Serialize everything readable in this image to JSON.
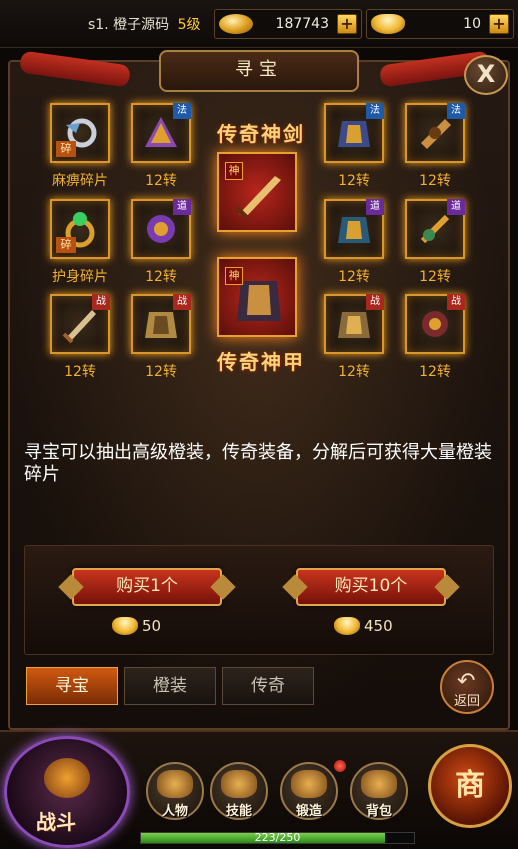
{
  "header": {
    "server_name": "s1. 橙子源码",
    "level": "5级",
    "gold": "187743",
    "ingot": "10",
    "plus_label": "+"
  },
  "panel": {
    "title": "寻宝",
    "close_label": "X",
    "legend_sword": "传奇神剑",
    "legend_armor": "传奇神甲",
    "shen_tag": "神",
    "items_left": [
      {
        "caption": "麻痹碎片",
        "tag": "",
        "frag": "碎",
        "icon": "ring-icon"
      },
      {
        "caption": "12转",
        "tag": "法",
        "frag": "",
        "icon": "gear-icon"
      },
      {
        "caption": "护身碎片",
        "tag": "",
        "frag": "碎",
        "icon": "ring-icon"
      },
      {
        "caption": "12转",
        "tag": "道",
        "frag": "",
        "icon": "gear-icon"
      },
      {
        "caption": "12转",
        "tag": "战",
        "frag": "",
        "icon": "sword-icon"
      },
      {
        "caption": "12转",
        "tag": "战",
        "frag": "",
        "icon": "armor-icon"
      }
    ],
    "items_right": [
      {
        "caption": "12转",
        "tag": "法",
        "icon": "armor-icon"
      },
      {
        "caption": "12转",
        "tag": "法",
        "icon": "gear-icon"
      },
      {
        "caption": "12转",
        "tag": "道",
        "icon": "armor-icon"
      },
      {
        "caption": "12转",
        "tag": "道",
        "icon": "gear-icon"
      },
      {
        "caption": "12转",
        "tag": "战",
        "icon": "armor-icon"
      },
      {
        "caption": "12转",
        "tag": "战",
        "icon": "gear-icon"
      }
    ],
    "description": "寻宝可以抽出高级橙装，传奇装备，分解后可获得大量橙装碎片"
  },
  "buy": {
    "one_label": "购买1个",
    "one_price": "50",
    "ten_label": "购买10个",
    "ten_price": "450"
  },
  "tabs": [
    {
      "label": "寻宝",
      "active": true
    },
    {
      "label": "橙装",
      "active": false
    },
    {
      "label": "传奇",
      "active": false
    }
  ],
  "back_label": "返回",
  "dock": {
    "battle_label": "战斗",
    "buttons": [
      {
        "label": "人物"
      },
      {
        "label": "技能"
      },
      {
        "label": "锻造"
      },
      {
        "label": "背包"
      }
    ],
    "shop_label": "商",
    "exp_text": "223/250",
    "exp_fraction": 0.892
  },
  "colors": {
    "accent_gold": "#f0b030",
    "button_red": "#c8341e",
    "tab_active": "#d05a10"
  }
}
